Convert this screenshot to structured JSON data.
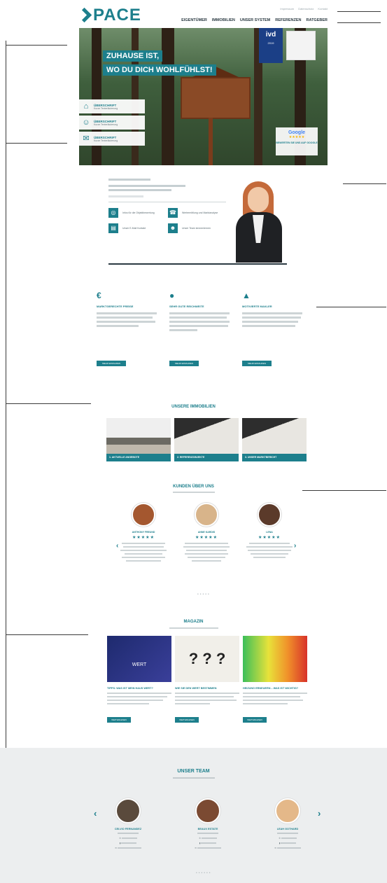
{
  "brand": {
    "logo": "PACE",
    "accent": "#1d7f8c"
  },
  "topbar": [
    "Impressum",
    "Datenschutz",
    "Kontakt"
  ],
  "nav": [
    "EIGENTÜMER",
    "IMMOBILIEN",
    "UNSER SYSTEM",
    "REFERENZEN",
    "RATGEBER"
  ],
  "hero": {
    "title_1": "ZUHAUSE IST,",
    "title_2": "WO DU DICH WOHLFÜHLST!",
    "badge_ivd": "ivd",
    "badge_year": "2019",
    "features": [
      {
        "title": "ÜBERSCHRIFT",
        "subtitle": "Kurze Texterläuterung",
        "icon": "house-icon"
      },
      {
        "title": "ÜBERSCHRIFT",
        "subtitle": "Kurze Texterläuterung",
        "icon": "people-icon"
      },
      {
        "title": "ÜBERSCHRIFT",
        "subtitle": "Kurze Texterläuterung",
        "icon": "chat-icon"
      }
    ],
    "google": {
      "label": "Google",
      "cta": "BEWERTEN SIE UNS AUF GOOGLE"
    }
  },
  "contact": {
    "items": [
      "Infos für die Objektbewertung",
      "Wertermittlung und Marktanalyse",
      "Unser E-Mail Kontakt",
      "Unser Team kennenlernen"
    ]
  },
  "columns": [
    {
      "icon": "€",
      "title": "MARKTGERECHTE PREISE",
      "button": "MEHR ERFAHREN"
    },
    {
      "icon": "●",
      "title": "SEHR GUTE REICHWEITE",
      "button": "MEHR ERFAHREN"
    },
    {
      "icon": "▲",
      "title": "MOTIVIERTE MAKLER",
      "button": "MEHR ERFAHREN"
    }
  ],
  "properties": {
    "title": "UNSERE IMMOBILIEN",
    "items": [
      "1. AKTUELLE ANGEBOTE",
      "2. REFERENZOBJEKTE",
      "3. UNSER MARKTBERICHT"
    ]
  },
  "reviews": {
    "title": "KUNDEN ÜBER UNS",
    "items": [
      {
        "name": "ANTHONY FREUND",
        "stars": "★★★★★"
      },
      {
        "name": "ANNE KARDIS",
        "stars": "★★★★★"
      },
      {
        "name": "LENA",
        "stars": "★★★★★"
      }
    ],
    "arrow_prev": "‹",
    "arrow_next": "›",
    "dots": "•••••"
  },
  "magazine": {
    "title": "MAGAZIN",
    "items": [
      {
        "image_text": "WERT",
        "title": "TIPPS: WAS IST MEIN HAUS WERT?",
        "button": "WEITERLESEN"
      },
      {
        "image_text": "? ? ?",
        "title": "WIE SIE DEN WERT BESTIMMEN",
        "button": "WEITERLESEN"
      },
      {
        "image_text": "",
        "title": "HEIZUNG ERNEUERN – WAS IST WICHTIG?",
        "button": "WEITERLESEN"
      }
    ]
  },
  "team": {
    "title": "UNSER TEAM",
    "members": [
      {
        "name": "CELVIO FERNANDEZ"
      },
      {
        "name": "BEAUX ESTATE"
      },
      {
        "name": "LEAH GOTHARD"
      }
    ],
    "arrow_prev": "‹",
    "arrow_next": "›",
    "dots": "••••••"
  }
}
